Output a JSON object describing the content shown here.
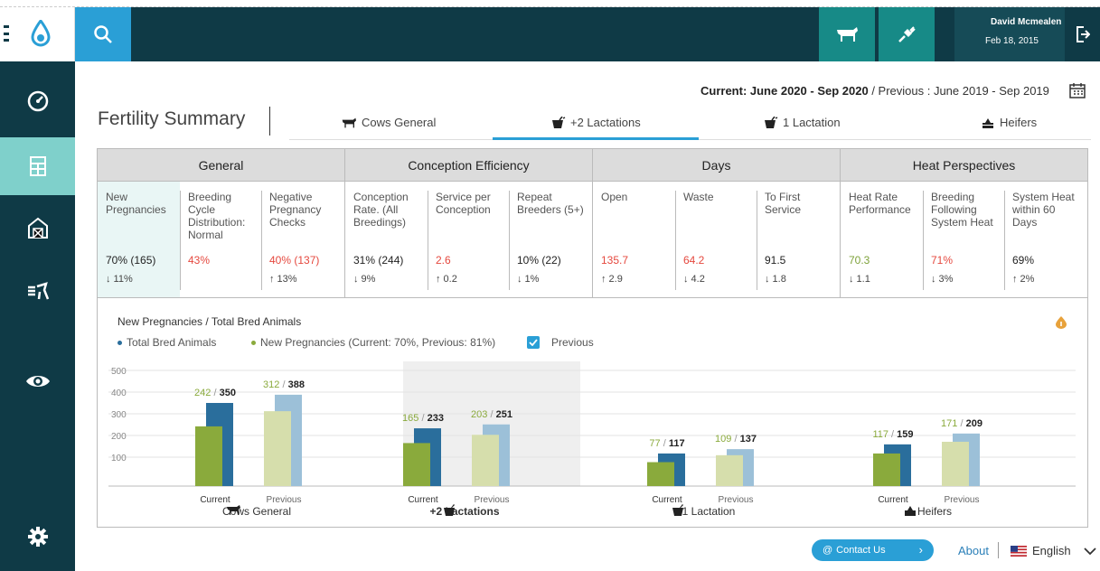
{
  "header": {
    "user_name": "David Mcmealen",
    "user_date": "Feb 18, 2015"
  },
  "period": {
    "current_label": "Current: June 2020 - Sep 2020",
    "previous_label": " / Previous : June 2019 - Sep 2019"
  },
  "page": {
    "title": "Fertility Summary",
    "tabs": [
      {
        "label": "Cows General",
        "icon": "cow-icon"
      },
      {
        "label": "+2 Lactations",
        "icon": "bottle-icon"
      },
      {
        "label": "1 Lactation",
        "icon": "bottle-icon"
      },
      {
        "label": "Heifers",
        "icon": "heifer-icon"
      }
    ],
    "active_tab": 1
  },
  "metrics": {
    "groups": [
      {
        "title": "General",
        "cells": [
          {
            "label": "New Pregnancies",
            "value": "70% (165)",
            "change": "↓ 11%",
            "color": "normal",
            "highlight": true
          },
          {
            "label": "Breeding Cycle Distribution: Normal",
            "value": "43%",
            "change": "",
            "color": "red"
          },
          {
            "label": "Negative Pregnancy Checks",
            "value": "40% (137)",
            "change": "↑ 13%",
            "color": "red"
          }
        ]
      },
      {
        "title": "Conception Efficiency",
        "cells": [
          {
            "label": "Conception Rate. (All Breedings)",
            "value": "31% (244)",
            "change": "↓ 9%",
            "color": "normal"
          },
          {
            "label": "Service per Conception",
            "value": "2.6",
            "change": "↑ 0.2",
            "color": "red"
          },
          {
            "label": "Repeat Breeders (5+)",
            "value": "10% (22)",
            "change": "↓ 1%",
            "color": "normal"
          }
        ]
      },
      {
        "title": "Days",
        "cells": [
          {
            "label": "Open",
            "value": "135.7",
            "change": "↑ 2.9",
            "color": "red"
          },
          {
            "label": "Waste",
            "value": "64.2",
            "change": "↓ 4.2",
            "color": "red"
          },
          {
            "label": "To First Service",
            "value": "91.5",
            "change": "↓ 1.8",
            "color": "normal"
          }
        ]
      },
      {
        "title": "Heat Perspectives",
        "cells": [
          {
            "label": "Heat Rate Performance",
            "value": "70.3",
            "change": "↓ 1.1",
            "color": "green"
          },
          {
            "label": "Breeding Following System Heat",
            "value": "71%",
            "change": "↓ 3%",
            "color": "red"
          },
          {
            "label": "System Heat within 60 Days",
            "value": "69%",
            "change": "↑ 2%",
            "color": "normal"
          }
        ]
      }
    ]
  },
  "chart_panel": {
    "title": "New Pregnancies / Total Bred Animals",
    "legend_total": "Total Bred Animals",
    "legend_new": "New Pregnancies (Current: 70%, Previous: 81%)",
    "previous_label": "Previous",
    "previous_checked": true
  },
  "chart_data": {
    "type": "bar",
    "title": "New Pregnancies / Total Bred Animals",
    "ylim": [
      0,
      500
    ],
    "yticks": [
      100,
      200,
      300,
      400,
      500
    ],
    "groups": [
      {
        "label": "Cows General",
        "icon": "cow-icon",
        "bold": false,
        "current": {
          "new": 242,
          "total": 350
        },
        "previous": {
          "new": 312,
          "total": 388
        }
      },
      {
        "label": "+2 Lactations",
        "icon": "bottle-icon",
        "bold": true,
        "shaded": true,
        "current": {
          "new": 165,
          "total": 233
        },
        "previous": {
          "new": 203,
          "total": 251
        }
      },
      {
        "label": "1 Lactation",
        "icon": "bottle-icon",
        "bold": false,
        "current": {
          "new": 77,
          "total": 117
        },
        "previous": {
          "new": 109,
          "total": 137
        }
      },
      {
        "label": "Heifers",
        "icon": "heifer-icon",
        "bold": false,
        "current": {
          "new": 117,
          "total": 159
        },
        "previous": {
          "new": 171,
          "total": 209
        }
      }
    ],
    "bar_labels": {
      "current": "Current",
      "previous": "Previous"
    },
    "colors": {
      "current_total": "#2a6e9c",
      "current_new": "#8aaa3c",
      "previous_total": "#9cc0d8",
      "previous_new": "#d6deac",
      "label_new": "#8aaa3c",
      "label_total": "#222"
    }
  },
  "footer": {
    "contact_label": "Contact Us",
    "about_label": "About",
    "language": "English"
  }
}
